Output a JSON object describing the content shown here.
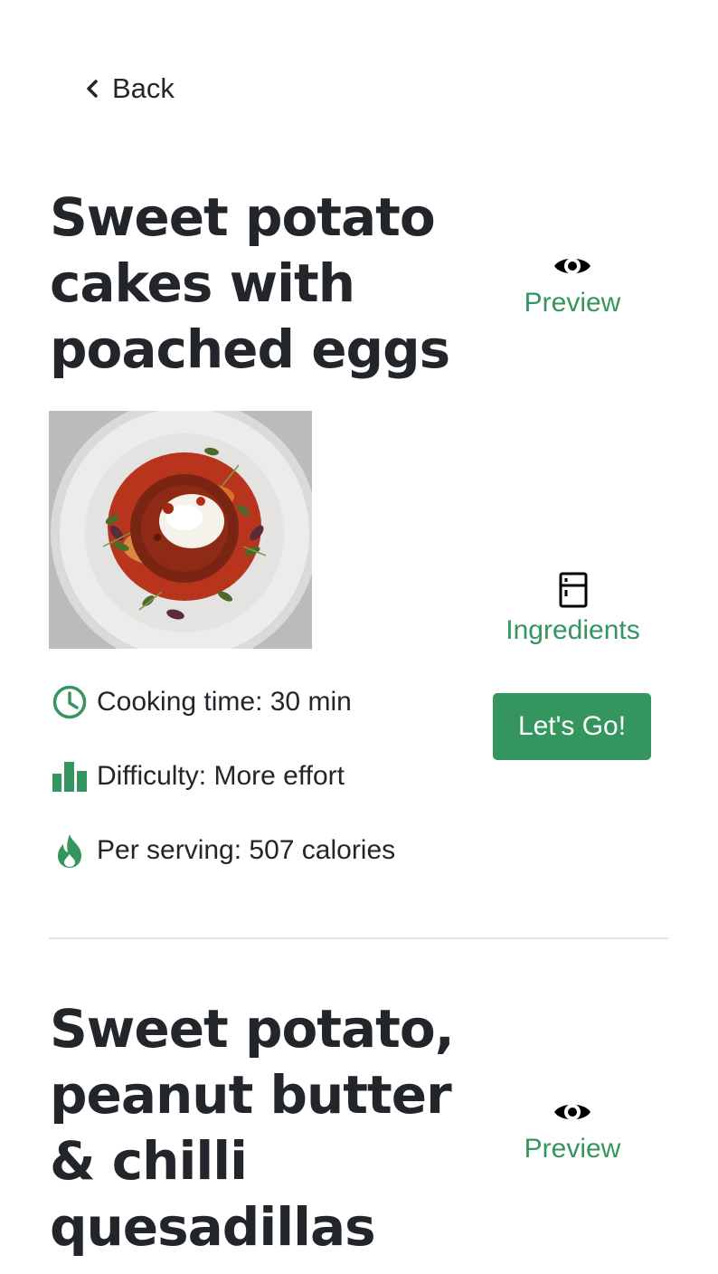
{
  "nav": {
    "back_label": "Back"
  },
  "colors": {
    "accent": "#35955e",
    "text": "#22262b",
    "divider": "#e3e3e3"
  },
  "recipes": [
    {
      "title": "Sweet potato cakes with poached eggs",
      "preview_label": "Preview",
      "ingredients_label": "Ingredients",
      "cta_label": "Let's Go!",
      "cooking_time": "Cooking time: 30 min",
      "difficulty": "Difficulty: More effort",
      "calories": "Per serving: 507 calories",
      "image_icon": "plate-photo"
    },
    {
      "title": "Sweet potato, peanut butter & chilli quesadillas",
      "preview_label": "Preview"
    }
  ]
}
